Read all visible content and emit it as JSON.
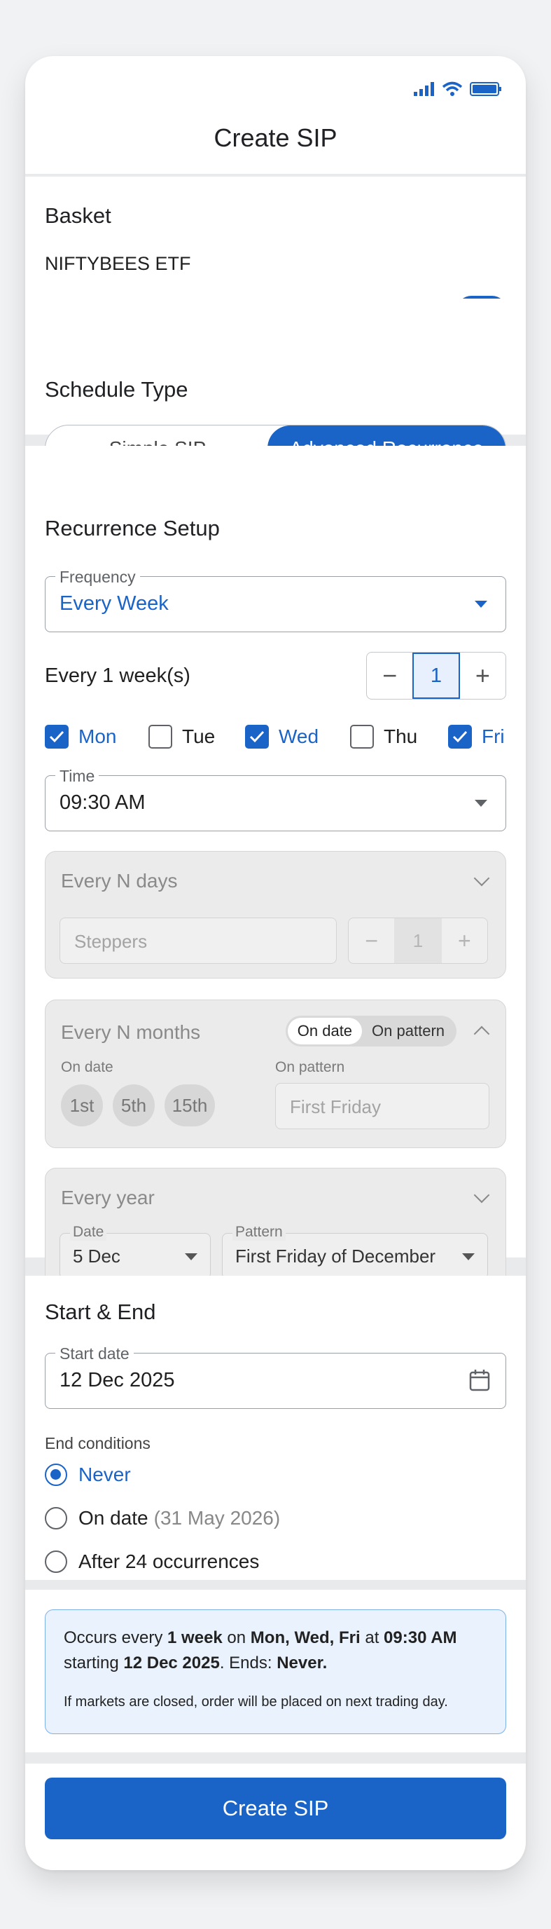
{
  "header": {
    "title": "Create SIP"
  },
  "basket": {
    "title": "Basket",
    "item": "NIFTYBEES ETF",
    "enabled": true
  },
  "schedule": {
    "title": "Schedule Type",
    "options": [
      "Simple SIP",
      "Advanced Recurrence"
    ],
    "selected": "Advanced Recurrence"
  },
  "recurrence": {
    "title": "Recurrence Setup",
    "frequency": {
      "label": "Frequency",
      "value": "Every Week"
    },
    "interval": {
      "label": "Every 1 week(s)",
      "value": "1",
      "minus": "−",
      "plus": "+"
    },
    "days": [
      {
        "label": "Mon",
        "checked": true
      },
      {
        "label": "Tue",
        "checked": false
      },
      {
        "label": "Wed",
        "checked": true
      },
      {
        "label": "Thu",
        "checked": false
      },
      {
        "label": "Fri",
        "checked": true
      }
    ],
    "time": {
      "label": "Time",
      "value": "09:30 AM"
    },
    "n_days": {
      "title": "Every N days",
      "placeholder": "Steppers",
      "value": "1",
      "minus": "−",
      "plus": "+"
    },
    "n_months": {
      "title": "Every N months",
      "toggle": [
        "On date",
        "On pattern"
      ],
      "toggle_selected": "On date",
      "on_date_label": "On date",
      "dates": [
        "1st",
        "5th",
        "15th"
      ],
      "on_pattern_label": "On pattern",
      "pattern_placeholder": "First Friday"
    },
    "year": {
      "title": "Every year",
      "date": {
        "label": "Date",
        "value": "5 Dec"
      },
      "pattern": {
        "label": "Pattern",
        "value": "First Friday of December"
      }
    }
  },
  "start_end": {
    "title": "Start & End",
    "start": {
      "label": "Start date",
      "value": "12 Dec 2025"
    },
    "end_label": "End conditions",
    "options": [
      {
        "label": "Never",
        "extra": "",
        "selected": true
      },
      {
        "label": "On date",
        "extra": "(31 May 2026)",
        "selected": false
      },
      {
        "label": "After 24 occurrences",
        "extra": "",
        "selected": false
      }
    ]
  },
  "summary": {
    "p1": "Occurs every ",
    "b1": "1 week",
    "p2": " on ",
    "b2": "Mon, Wed, Fri",
    "p3": " at ",
    "b3": "09:30 AM",
    "p4": "starting ",
    "b4": "12 Dec 2025",
    "p5": ". Ends: ",
    "b5": "Never.",
    "note": "If markets are closed, order will be placed on next trading day."
  },
  "cta": {
    "label": "Create SIP"
  },
  "colors": {
    "accent": "#1a63c7",
    "summary_bg": "#eaf3fd"
  }
}
